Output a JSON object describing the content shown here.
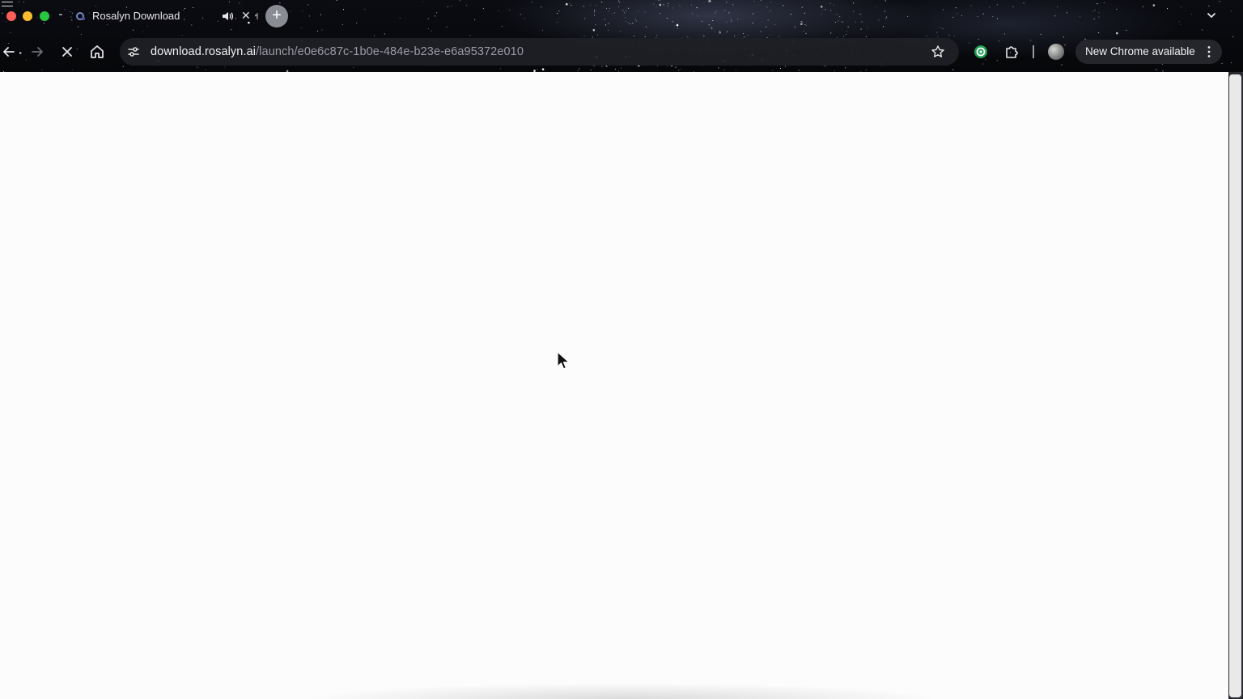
{
  "window": {
    "traffic_lights": {
      "close": "#fe5f57",
      "minimize": "#febc2e",
      "zoom": "#28c840"
    }
  },
  "tab": {
    "title": "Rosalyn Download",
    "favicon": "rosalyn-logo-icon",
    "audio_icon": "speaker-icon",
    "close_glyph": "✕"
  },
  "new_tab_glyph": "+",
  "toolbar": {
    "back_icon": "arrow-left-icon",
    "forward_icon": "arrow-right-icon",
    "stop_icon": "close-icon",
    "home_icon": "home-icon"
  },
  "address_bar": {
    "host": "download.rosalyn.ai",
    "path": "/launch/e0e6c87c-1b0e-484e-b23e-e6a95372e010"
  },
  "update_button": {
    "label": "New Chrome available"
  },
  "colors": {
    "page_background": "#fcfcfc",
    "toolbar_background": "#0b0c12",
    "omnibox_background": "#202126"
  }
}
